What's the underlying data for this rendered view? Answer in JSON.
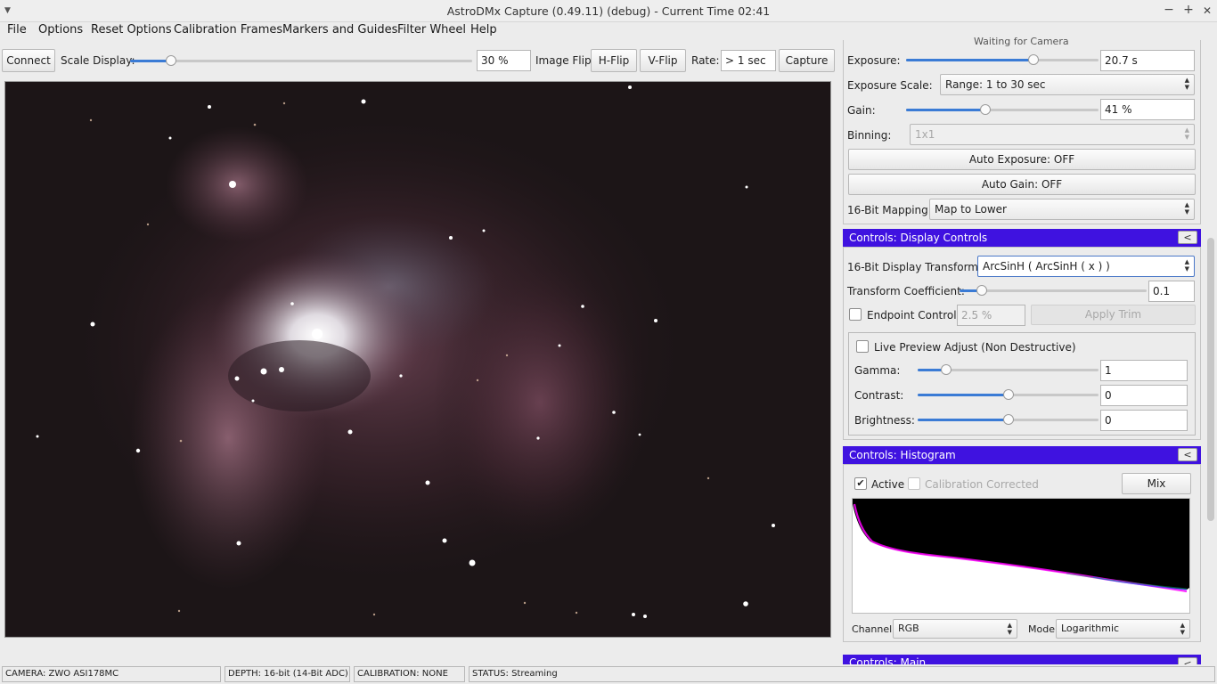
{
  "window": {
    "title": "AstroDMx Capture (0.49.11) (debug) - Current Time 02:41",
    "controls": {
      "minimize": "−",
      "maximize": "+",
      "close": "✕"
    }
  },
  "menu": [
    "File",
    "Options",
    "Reset Options",
    "Calibration Frames",
    "Markers and Guides",
    "Filter Wheel",
    "Help"
  ],
  "toolbar": {
    "connect_label": "Connect",
    "scale_label": "Scale Display:",
    "scale_value": "30 %",
    "scale_level": 0.12,
    "flip_label": "Image Flip:",
    "hflip_label": "H-Flip",
    "vflip_label": "V-Flip",
    "rate_label": "Rate:",
    "rate_value": "> 1 sec",
    "capture_label": "Capture"
  },
  "camera_controls": {
    "status_text": "Waiting for Camera",
    "exposure_label": "Exposure:",
    "exposure_value": "20.7 s",
    "exposure_level": 0.66,
    "exposure_scale_label": "Exposure Scale:",
    "exposure_scale_value": "Range: 1 to 30 sec",
    "gain_label": "Gain:",
    "gain_value": "41 %",
    "gain_level": 0.41,
    "binning_label": "Binning:",
    "binning_value": "1x1",
    "auto_exposure_label": "Auto Exposure: OFF",
    "auto_gain_label": "Auto Gain: OFF",
    "mapping_label": "16-Bit Mapping:",
    "mapping_value": "Map to Lower"
  },
  "display_controls": {
    "header": "Controls: Display Controls",
    "collapse_label": "<",
    "transform_label": "16-Bit Display Transform:",
    "transform_value": "ArcSinH ( ArcSinH ( x ) )",
    "coefficient_label": "Transform Coefficient:",
    "coefficient_value": "0.1",
    "coefficient_level": 0.12,
    "endpoint_label": "Endpoint Control:",
    "endpoint_value": "2.5 %",
    "apply_trim_label": "Apply Trim",
    "live_preview_label": "Live Preview Adjust (Non Destructive)",
    "gamma_label": "Gamma:",
    "gamma_value": "1",
    "gamma_level": 0.16,
    "contrast_label": "Contrast:",
    "contrast_value": "0",
    "contrast_level": 0.5,
    "brightness_label": "Brightness:",
    "brightness_value": "0",
    "brightness_level": 0.5
  },
  "histogram": {
    "header": "Controls: Histogram",
    "collapse_label": "<",
    "active_label": "Active",
    "active_checked": "✔",
    "calibration_label": "Calibration Corrected",
    "mix_label": "Mix",
    "channel_label": "Channel:",
    "channel_value": "RGB",
    "mode_label": "Mode:",
    "mode_value": "Logarithmic"
  },
  "main_panel": {
    "header": "Controls: Main",
    "collapse_label": "<"
  },
  "status": {
    "camera": "CAMERA: ZWO ASI178MC",
    "depth": "DEPTH: 16-bit (14-Bit ADC)",
    "calibration": "CALIBRATION: NONE",
    "state": "STATUS: Streaming"
  },
  "colors": {
    "panel_header": "#3f12e0",
    "slider_fill": "#3a7bd5",
    "image_background": "#1b1416"
  },
  "icons": {
    "window_menu": "chevron-down-icon",
    "close": "close-icon",
    "spin_arrows": "up-down-arrows-icon"
  }
}
